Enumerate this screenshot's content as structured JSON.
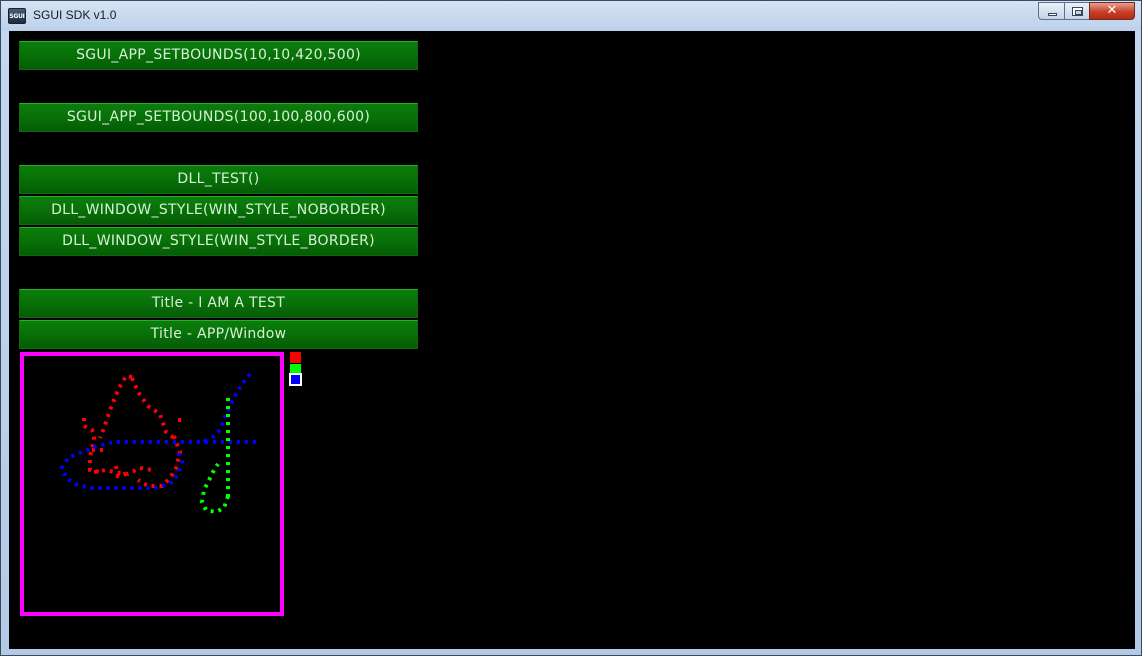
{
  "window": {
    "app_icon_text": "SGUI",
    "title": "SGUI SDK v1.0",
    "close_glyph": "✕"
  },
  "buttons": [
    {
      "label": "SGUI_APP_SETBOUNDS(10,10,420,500)"
    },
    {
      "label": "SGUI_APP_SETBOUNDS(100,100,800,600)"
    },
    {
      "label": "DLL_TEST()"
    },
    {
      "label": "DLL_WINDOW_STYLE(WIN_STYLE_NOBORDER)"
    },
    {
      "label": "DLL_WINDOW_STYLE(WIN_STYLE_BORDER)"
    },
    {
      "label": "Title - I AM A TEST"
    },
    {
      "label": "Title - APP/Window"
    }
  ],
  "canvas": {
    "frame_color": "#ff00ff",
    "background": "#000000"
  },
  "palette": [
    {
      "name": "red",
      "color": "#ff0000",
      "selected": false
    },
    {
      "name": "green",
      "color": "#00ff00",
      "selected": false
    },
    {
      "name": "blue",
      "color": "#0000ff",
      "selected": true
    }
  ]
}
